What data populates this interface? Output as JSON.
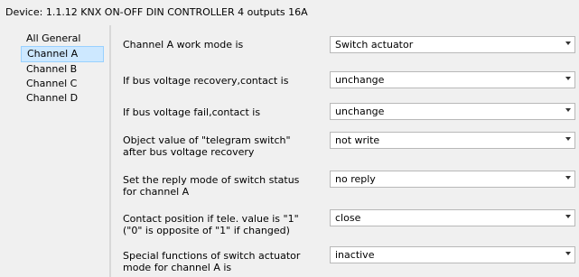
{
  "header": {
    "title": "Device: 1.1.12  KNX ON-OFF DIN CONTROLLER 4 outputs 16A"
  },
  "sidebar": {
    "items": [
      {
        "label": "All General"
      },
      {
        "label": "Channel A"
      },
      {
        "label": "Channel B"
      },
      {
        "label": "Channel C"
      },
      {
        "label": "Channel D"
      }
    ],
    "selected": "Channel A"
  },
  "params": [
    {
      "label": "Channel A work mode is",
      "value": "Switch actuator"
    },
    {
      "label": "If bus voltage recovery,contact is",
      "value": "unchange"
    },
    {
      "label": "If bus voltage fail,contact is",
      "value": "unchange"
    },
    {
      "label": "Object value of \"telegram switch\"",
      "label2": "after bus voltage recovery",
      "value": "not write"
    },
    {
      "label": "Set the reply mode of switch status",
      "label2": "for channel A",
      "value": "no reply"
    },
    {
      "label": "Contact position if tele. value is \"1\"",
      "label2": " (\"0\" is opposite of \"1\" if changed)",
      "value": "close"
    },
    {
      "label": "Special functions of switch actuator",
      "label2": " mode for channel A is",
      "value": "inactive"
    }
  ],
  "icons": {
    "dropdown": "chevron-down-icon"
  }
}
